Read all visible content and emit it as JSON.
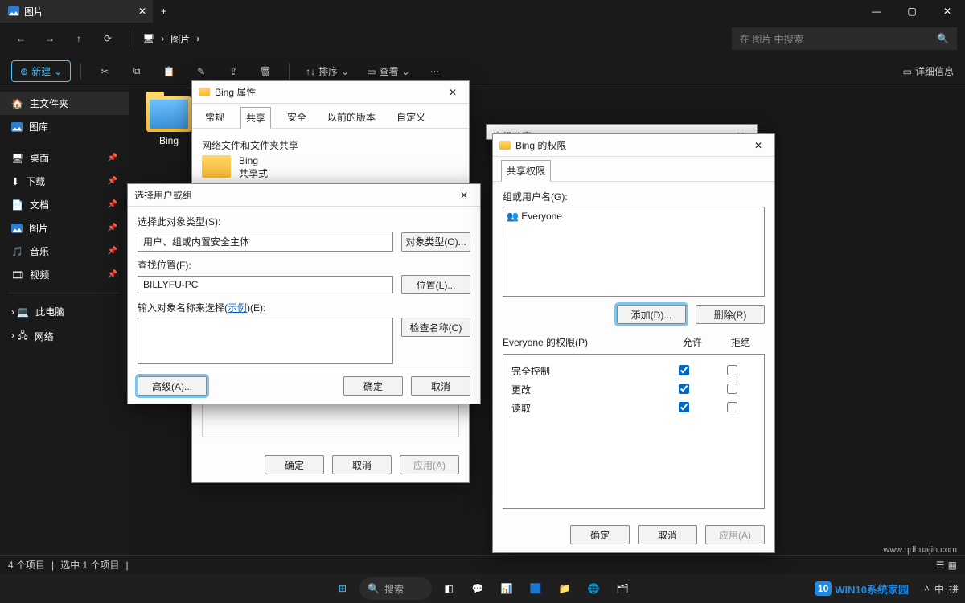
{
  "window": {
    "tab_title": "图片",
    "min": "—",
    "max": "▢",
    "close": "✕",
    "plus": "+"
  },
  "nav": {
    "back": "←",
    "fwd": "→",
    "up": "↑",
    "refresh": "⟳",
    "monitor": "🖥",
    "chev": "›",
    "crumb": "图片",
    "search_ph": "在 图片 中搜索",
    "search_icon": "🔍"
  },
  "toolbar": {
    "new": "新建",
    "new_plus": "⊕",
    "chev": "⌄",
    "sort": "排序",
    "view": "查看",
    "details": "详细信息",
    "more": "⋯"
  },
  "sidebar": {
    "home": "主文件夹",
    "gallery": "图库",
    "desktop": "桌面",
    "downloads": "下载",
    "documents": "文档",
    "pictures": "图片",
    "music": "音乐",
    "videos": "视频",
    "thispc": "此电脑",
    "network": "网络"
  },
  "content": {
    "folder": "Bing"
  },
  "statusbar": {
    "count": "4 个项目",
    "sel": "选中 1 个项目"
  },
  "props": {
    "title": "Bing 属性",
    "tabs": [
      "常规",
      "共享",
      "安全",
      "以前的版本",
      "自定义"
    ],
    "section": "网络文件和文件夹共享",
    "name": "Bing",
    "mode": "共享式",
    "ok": "确定",
    "cancel": "取消",
    "apply": "应用(A)"
  },
  "selusr": {
    "title": "选择用户或组",
    "obj_label": "选择此对象类型(S):",
    "obj_value": "用户、组或内置安全主体",
    "obj_btn": "对象类型(O)...",
    "loc_label": "查找位置(F):",
    "loc_value": "BILLYFU-PC",
    "loc_btn": "位置(L)...",
    "name_label_a": "输入对象名称来选择(",
    "name_label_link": "示例",
    "name_label_b": ")(E):",
    "check_btn": "检查名称(C)",
    "adv_btn": "高级(A)...",
    "ok": "确定",
    "cancel": "取消"
  },
  "advshare": {
    "title": "高级共享"
  },
  "perm": {
    "title": "Bing 的权限",
    "tab": "共享权限",
    "group_label": "组或用户名(G):",
    "everyone": "Everyone",
    "add": "添加(D)...",
    "remove": "删除(R)",
    "perm_for": "Everyone 的权限(P)",
    "hdr_allow": "允许",
    "hdr_deny": "拒绝",
    "rows": [
      {
        "name": "完全控制",
        "allow": true,
        "deny": false
      },
      {
        "name": "更改",
        "allow": true,
        "deny": false
      },
      {
        "name": "读取",
        "allow": true,
        "deny": false
      }
    ],
    "ok": "确定",
    "cancel": "取消",
    "apply": "应用(A)"
  },
  "taskbar": {
    "search": "搜索",
    "lang": "中",
    "more": "拼"
  },
  "branding": {
    "badge": "10",
    "name": "WIN10系统家园",
    "url": "www.qdhuajin.com"
  },
  "watermark": "www.qdhuajin.com"
}
